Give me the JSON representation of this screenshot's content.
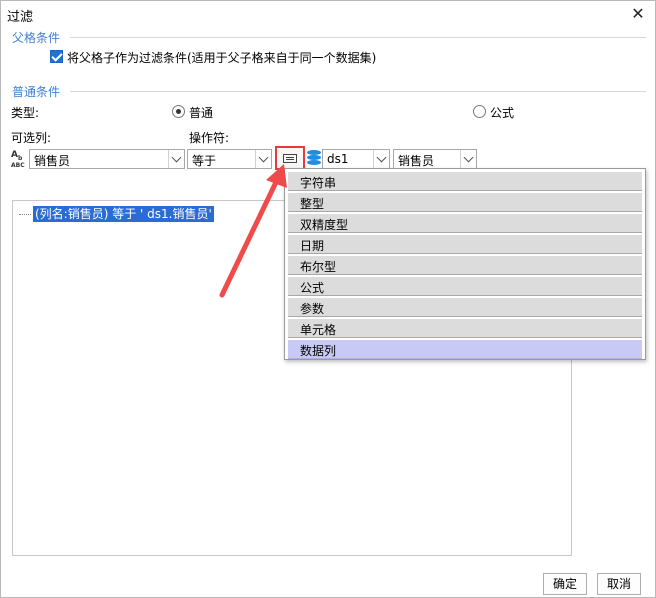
{
  "window": {
    "title": "过滤"
  },
  "parent_condition": {
    "section_label": "父格条件",
    "checkbox_label": "将父格子作为过滤条件(适用于父子格来自于同一个数据集)",
    "checked": true
  },
  "normal_condition": {
    "section_label": "普通条件",
    "type_label": "类型:",
    "type_options": [
      "普通",
      "公式"
    ],
    "selected_type": "普通",
    "column_label": "可选列:",
    "operator_label": "操作符:",
    "column_value": "销售员",
    "operator_value": "等于",
    "dataset_value": "ds1",
    "field_value": "销售员"
  },
  "tree": {
    "node_text": "(列名:销售员) 等于 ' ds1.销售员'"
  },
  "value_type_menu": {
    "items": [
      "字符串",
      "整型",
      "双精度型",
      "日期",
      "布尔型",
      "公式",
      "参数",
      "单元格",
      "数据列"
    ],
    "selected": "数据列"
  },
  "footer": {
    "ok_label": "确定",
    "cancel_label": "取消"
  },
  "colors": {
    "section_label": "#3f7fd0",
    "highlight": "#e53b3b",
    "selection": "#2b6bd4",
    "menu_selected": "#c9c9f6"
  },
  "icons": {
    "column_type": "abc-text-column-icon",
    "dataset": "database-icon",
    "value_type": "value-type-icon",
    "close": "close-icon",
    "annotation": "red-arrow"
  }
}
